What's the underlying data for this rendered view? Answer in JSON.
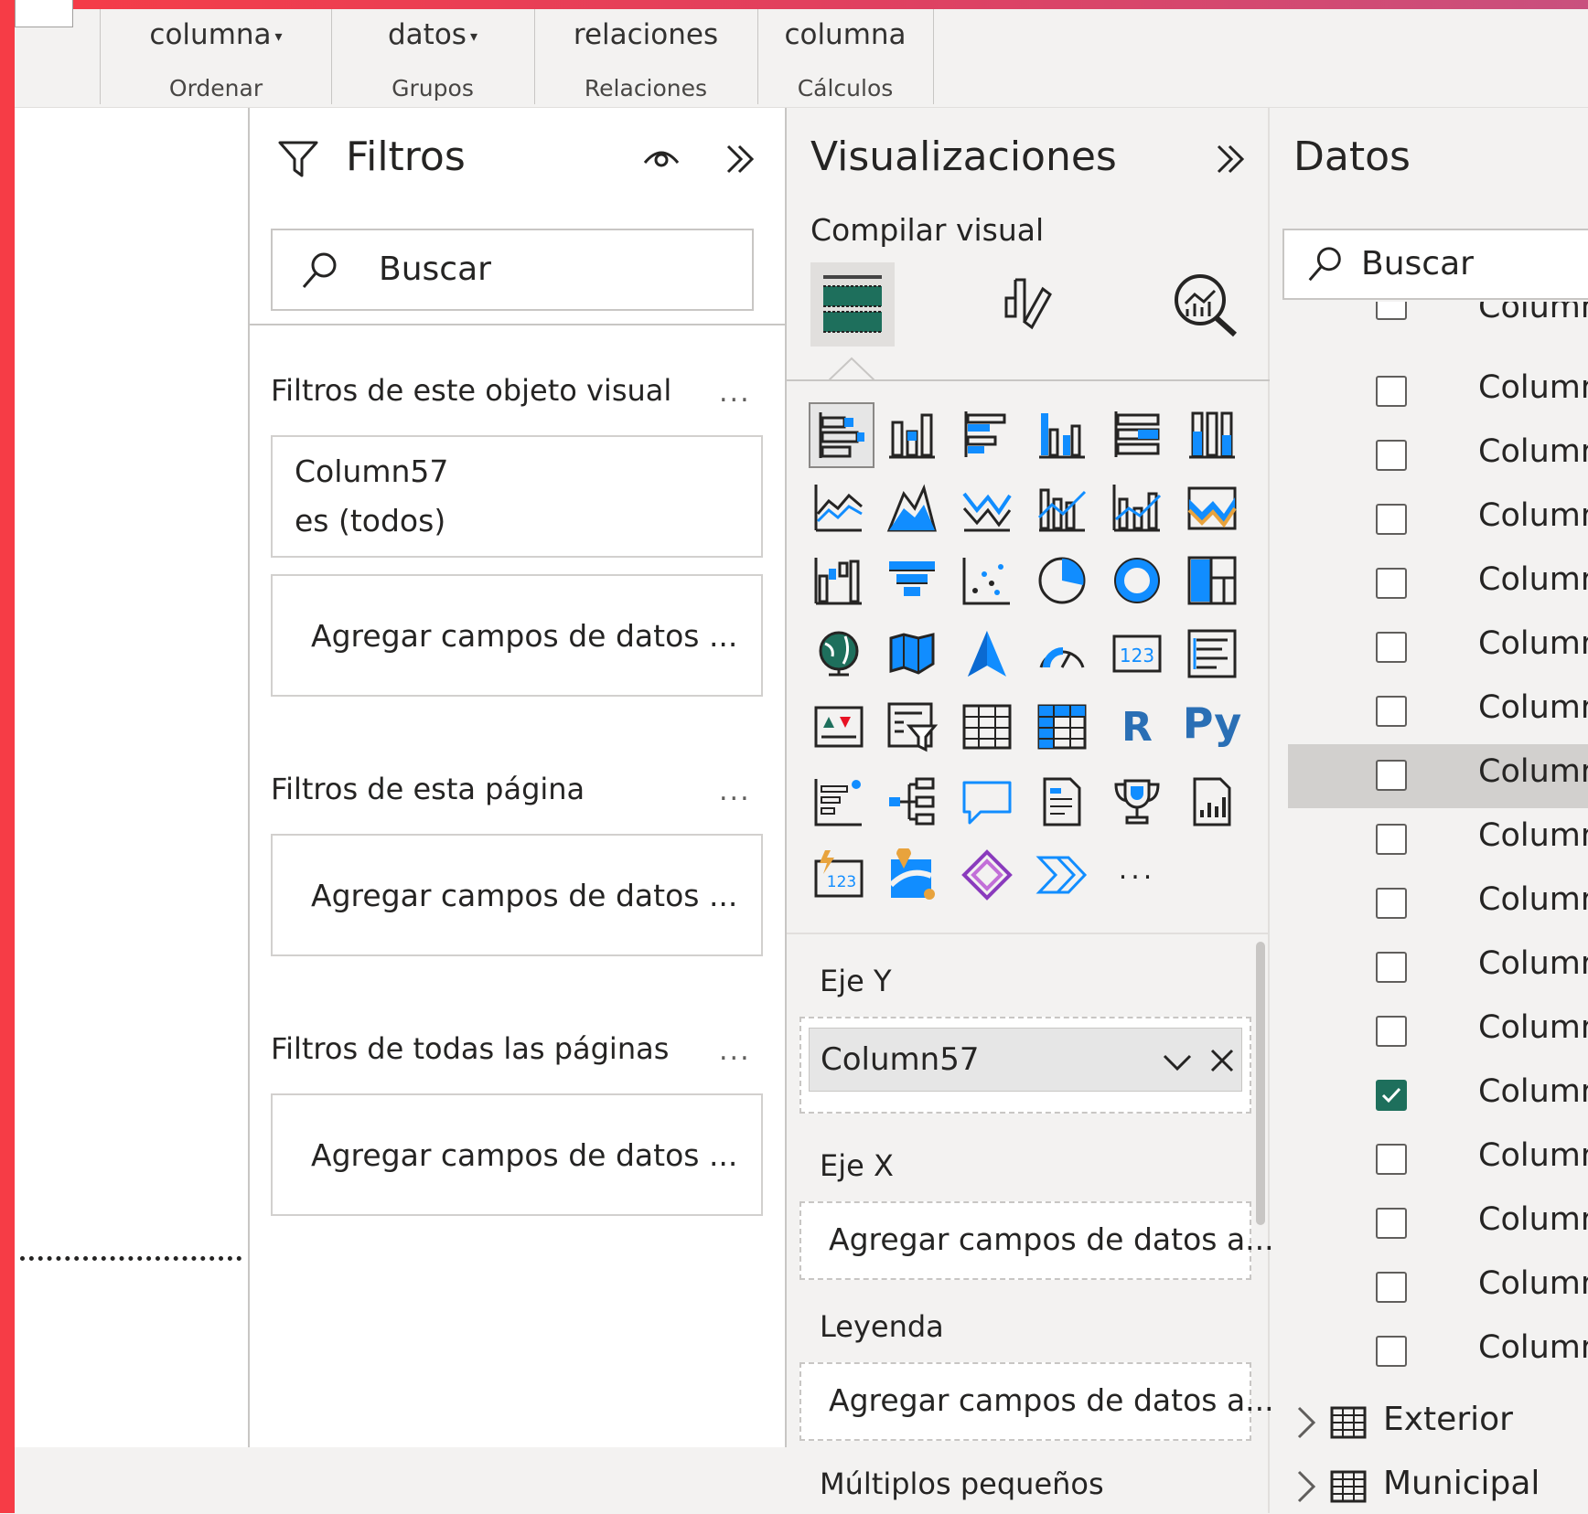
{
  "ribbon": {
    "groups": [
      {
        "command": "columna",
        "has_dropdown": true,
        "label": "Ordenar"
      },
      {
        "command": "datos",
        "has_dropdown": true,
        "label": "Grupos"
      },
      {
        "command": "relaciones",
        "has_dropdown": false,
        "label": "Relaciones"
      },
      {
        "command": "columna",
        "has_dropdown": false,
        "label": "Cálculos"
      }
    ]
  },
  "filters": {
    "title": "Filtros",
    "search_placeholder": "Buscar",
    "visual_section": "Filtros de este objeto visual",
    "page_section": "Filtros de esta página",
    "all_pages_section": "Filtros de todas las páginas",
    "more": "...",
    "applied_field": "Column57",
    "applied_condition": "es (todos)",
    "add_fields": "Agregar campos de datos ..."
  },
  "visualizations": {
    "title": "Visualizaciones",
    "build_visual": "Compilar visual",
    "more_visuals": "...",
    "r_label": "R",
    "py_label": "Py",
    "y_axis": "Eje Y",
    "y_axis_field": "Column57",
    "x_axis": "Eje X",
    "legend": "Leyenda",
    "small_multiples": "Múltiplos pequeños",
    "add_fields": "Agregar campos de datos a..."
  },
  "datos": {
    "title": "Datos",
    "search_placeholder": "Buscar",
    "column_label": "Column",
    "rows": [
      {
        "label": "Column",
        "checked": false,
        "highlighted": false
      },
      {
        "label": "Column",
        "checked": false,
        "highlighted": false
      },
      {
        "label": "Column",
        "checked": false,
        "highlighted": false
      },
      {
        "label": "Column",
        "checked": false,
        "highlighted": false
      },
      {
        "label": "Column",
        "checked": false,
        "highlighted": false
      },
      {
        "label": "Column",
        "checked": false,
        "highlighted": false
      },
      {
        "label": "Column",
        "checked": false,
        "highlighted": false
      },
      {
        "label": "Column",
        "checked": false,
        "highlighted": true
      },
      {
        "label": "Column",
        "checked": false,
        "highlighted": false
      },
      {
        "label": "Column",
        "checked": false,
        "highlighted": false
      },
      {
        "label": "Column",
        "checked": false,
        "highlighted": false
      },
      {
        "label": "Column",
        "checked": false,
        "highlighted": false
      },
      {
        "label": "Column",
        "checked": true,
        "highlighted": false
      },
      {
        "label": "Column",
        "checked": false,
        "highlighted": false
      },
      {
        "label": "Column",
        "checked": false,
        "highlighted": false
      },
      {
        "label": "Column",
        "checked": false,
        "highlighted": false
      },
      {
        "label": "Column",
        "checked": false,
        "highlighted": false
      }
    ],
    "tables": [
      "Exterior",
      "Municipal"
    ]
  },
  "colors": {
    "accent_red": "#f63c46",
    "check_green": "#1e6f5c",
    "icon_blue": "#118dff"
  }
}
